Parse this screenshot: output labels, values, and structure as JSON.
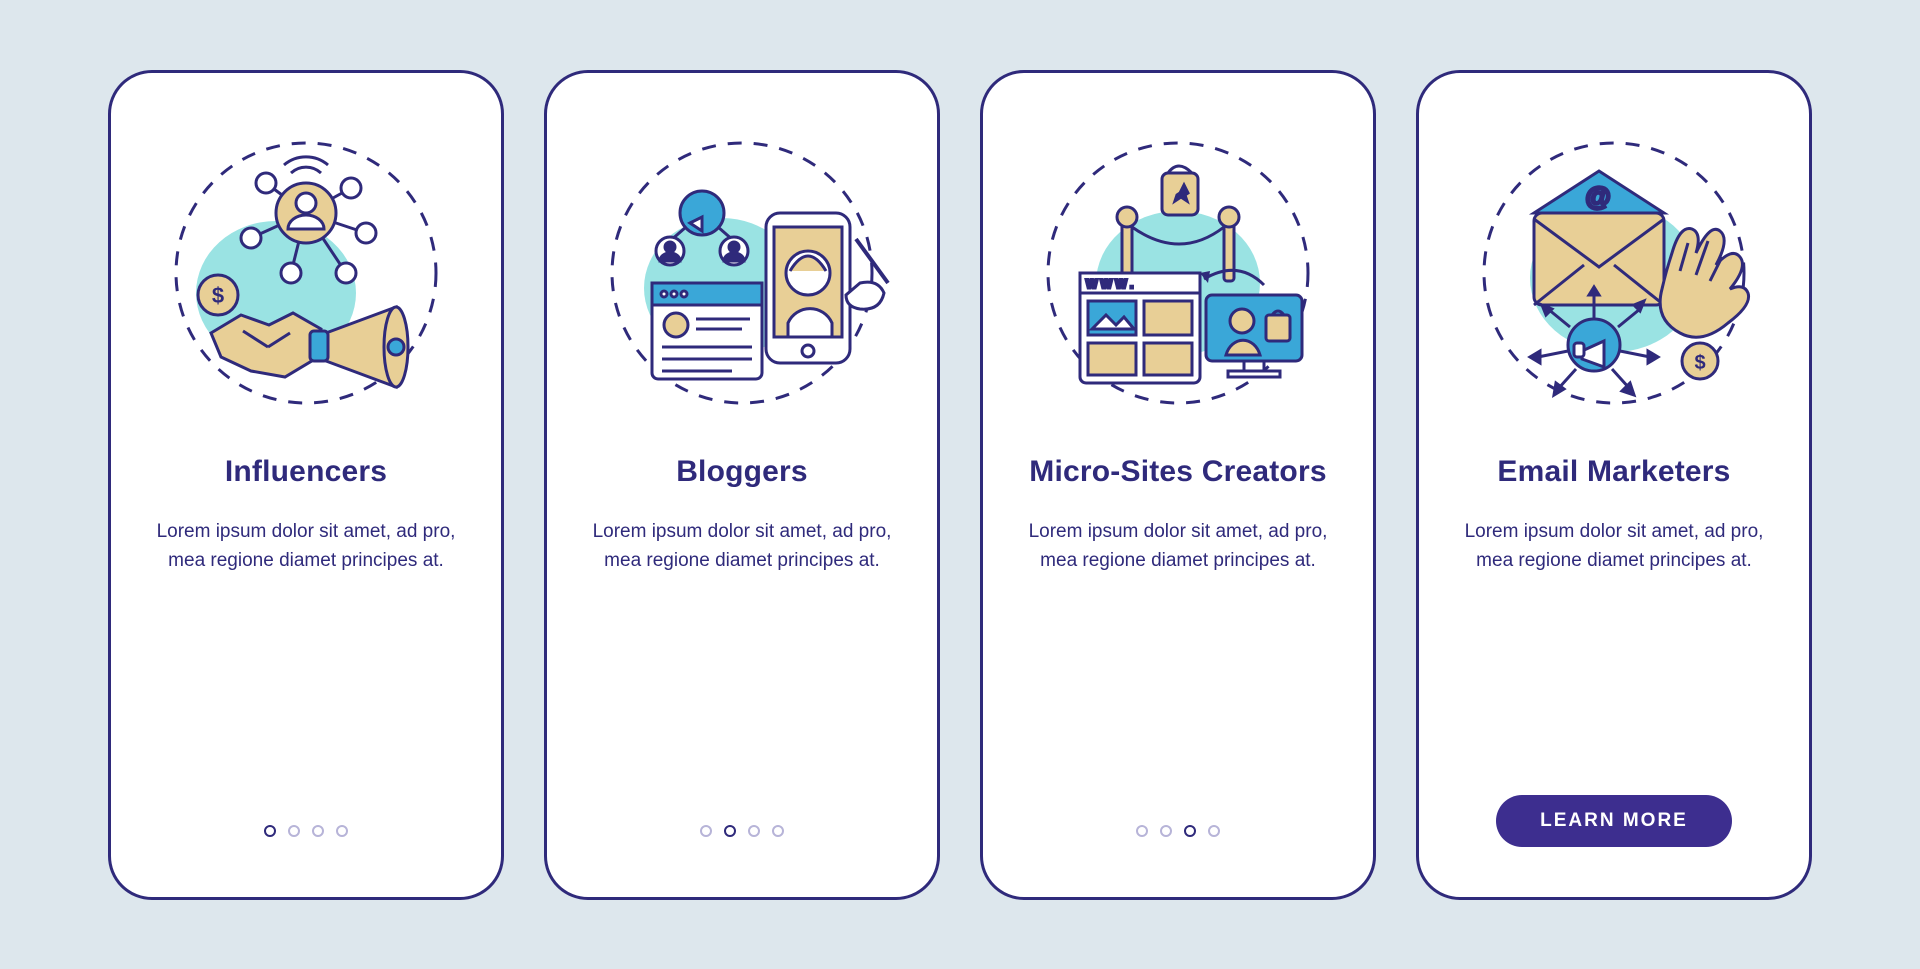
{
  "screens": [
    {
      "title": "Influencers",
      "description": "Lorem ipsum dolor sit amet, ad pro, mea regione diamet principes at.",
      "active_dot": 0,
      "total_dots": 4,
      "icon": "influencers-icon"
    },
    {
      "title": "Bloggers",
      "description": "Lorem ipsum dolor sit amet, ad pro, mea regione diamet principes at.",
      "active_dot": 1,
      "total_dots": 4,
      "icon": "bloggers-icon"
    },
    {
      "title": "Micro-Sites Creators",
      "description": "Lorem ipsum dolor sit amet, ad pro, mea regione diamet principes at.",
      "active_dot": 2,
      "total_dots": 4,
      "icon": "microsites-icon"
    },
    {
      "title": "Email Marketers",
      "description": "Lorem ipsum dolor sit amet, ad pro, mea regione diamet principes at.",
      "cta_label": "LEARN MORE",
      "icon": "email-marketers-icon"
    }
  ],
  "colors": {
    "brand": "#2f2a7b",
    "accent_blue": "#3aa7d8",
    "accent_cyan": "#9ae3e3",
    "accent_sand": "#e8cf96",
    "bg": "#dde7ed"
  }
}
